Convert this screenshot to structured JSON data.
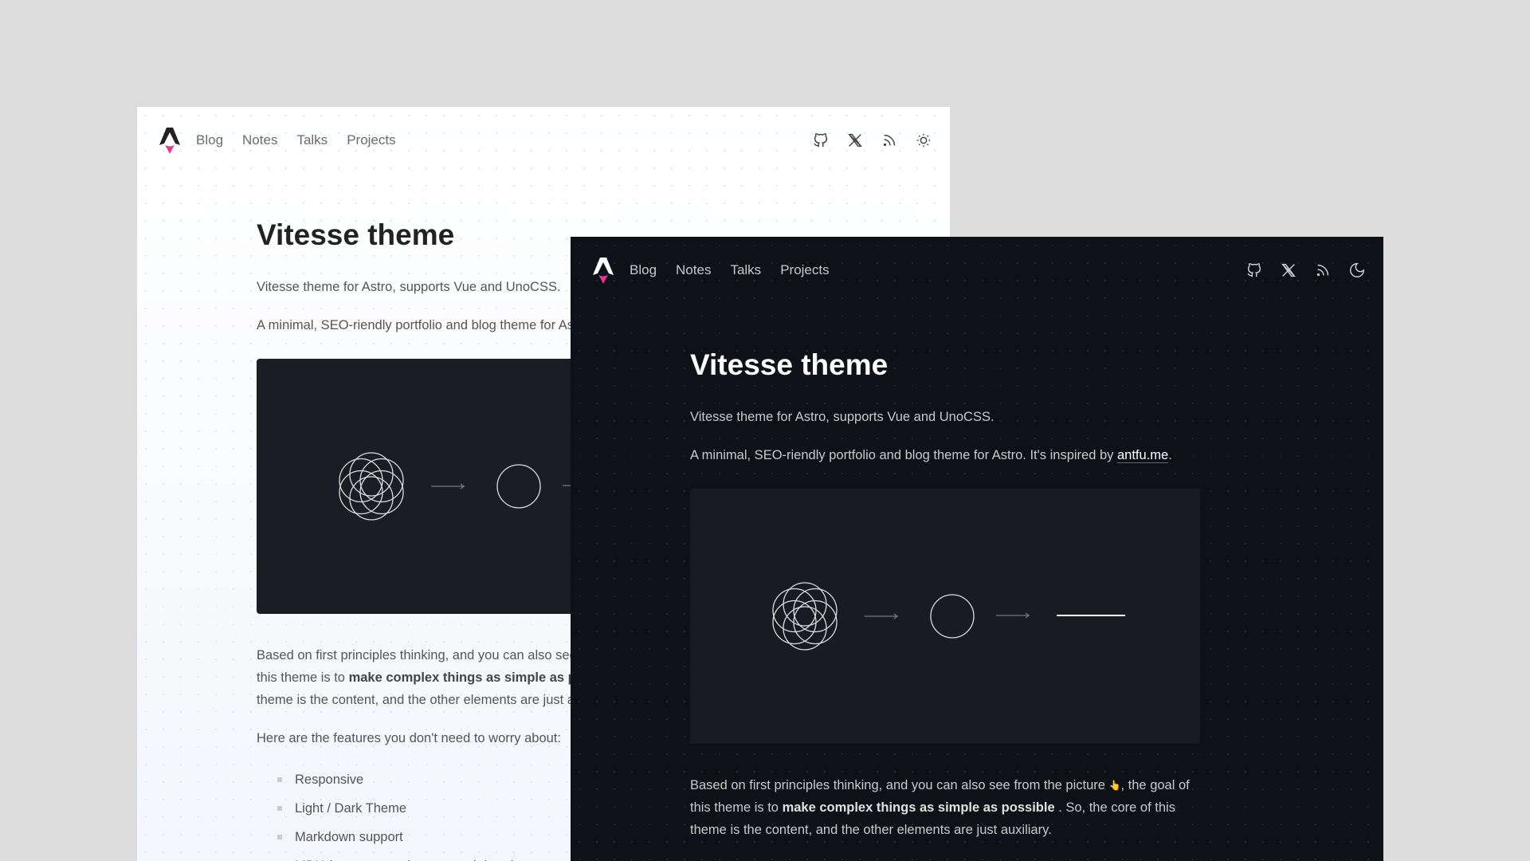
{
  "nav": {
    "items": [
      "Blog",
      "Notes",
      "Talks",
      "Projects"
    ],
    "icons": [
      "github-icon",
      "x-twitter-icon",
      "rss-icon",
      "theme-toggle-icon"
    ]
  },
  "light": {
    "theme_icon": "sun-icon"
  },
  "dark": {
    "theme_icon": "moon-icon"
  },
  "content": {
    "title": "Vitesse theme",
    "intro": "Vitesse theme for Astro, supports Vue and UnoCSS.",
    "desc_pre": "A minimal, SEO-riendly portfolio and blog theme for Astro. It's inspired by ",
    "desc_link": "antfu.me",
    "desc_post": ".",
    "p1_pre": "Based on first principles thinking, and you can also see from the picture ",
    "p1_emoji": "👆",
    "p1_mid": ", the goal of this theme is to ",
    "p1_bold": "make complex things as simple as possible",
    "p1_post": " . So, the core of this theme is the content, and the other elements are just auxiliary.",
    "features_intro": "Here are the features you don't need to worry about:",
    "features": [
      "Responsive",
      "Light / Dark Theme",
      "Markdown support",
      "MDX (components in your markdown)"
    ]
  },
  "colors": {
    "accent": "#e6378f",
    "page_bg": "#dcdcdc",
    "dark_bg": "#0e1117"
  }
}
